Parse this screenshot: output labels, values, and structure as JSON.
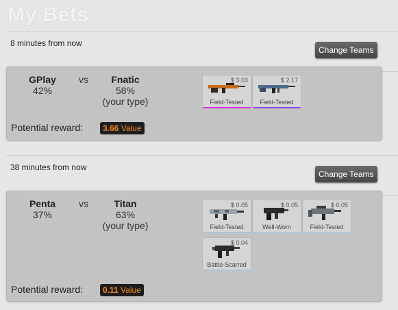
{
  "page": {
    "title": "My Bets"
  },
  "ui": {
    "change_teams": "Change Teams",
    "vs": "vs",
    "potential_reward": "Potential reward:",
    "value_word": "Value"
  },
  "bets": [
    {
      "time": "8 minutes from now",
      "team1": {
        "name": "GPlay",
        "pct": "42%",
        "note": ""
      },
      "team2": {
        "name": "Fnatic",
        "pct": "58%",
        "note": "(your type)"
      },
      "reward": "3.66",
      "items": [
        {
          "price": "$ 3.03",
          "condition": "Field-Tested",
          "icon": "rifle-orange-icon",
          "rarity_color": "#d32ce6"
        },
        {
          "price": "$ 2.17",
          "condition": "Field-Tested",
          "icon": "rifle-blue-icon",
          "rarity_color": "#8847ff"
        }
      ]
    },
    {
      "time": "38 minutes from now",
      "team1": {
        "name": "Penta",
        "pct": "37%",
        "note": ""
      },
      "team2": {
        "name": "Titan",
        "pct": "63%",
        "note": "(your type)"
      },
      "reward": "0.11",
      "items": [
        {
          "price": "$ 0.05",
          "condition": "Field-Tested",
          "icon": "smg-camo-icon",
          "rarity_color": "#b0c3d9"
        },
        {
          "price": "$ 0.05",
          "condition": "Well-Worn",
          "icon": "pistol-black-icon",
          "rarity_color": "#b0c3d9"
        },
        {
          "price": "$ 0.05",
          "condition": "Field-Tested",
          "icon": "smg-gray-icon",
          "rarity_color": "#b0c3d9"
        },
        {
          "price": "$ 0.04",
          "condition": "Battle-Scarred",
          "icon": "smg-black-icon",
          "rarity_color": "#b0c3d9"
        }
      ]
    }
  ]
}
